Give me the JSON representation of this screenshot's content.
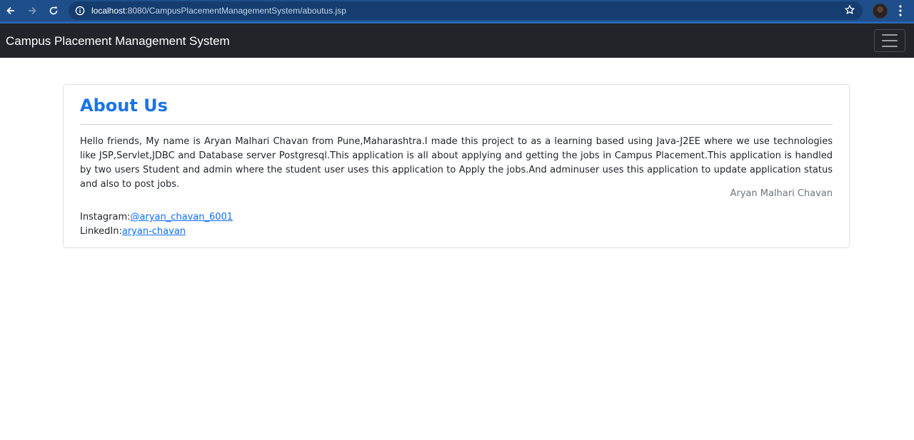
{
  "browser": {
    "url_host": "localhost",
    "url_rest": ":8080/CampusPlacementManagementSystem/aboutus.jsp"
  },
  "navbar": {
    "brand": "Campus Placement Management System"
  },
  "about": {
    "heading": "About Us",
    "paragraph": "Hello friends, My name is Aryan Malhari Chavan from Pune,Maharashtra.I made this project to as a learning based using Java-J2EE where we use technologies like JSP,Servlet,JDBC and Database server Postgresql.This application is all about applying and getting the jobs in Campus Placement.This application is handled by two users Student and admin where the student user uses this application to Apply the jobs.And adminuser uses this application to update application status and also to post jobs.",
    "signature": "Aryan Malhari Chavan",
    "instagram_label": "Instagram:",
    "instagram_handle": "@aryan_chavan_6001",
    "linkedin_label": "LinkedIn:",
    "linkedin_handle": "aryan-chavan"
  },
  "colors": {
    "chrome": "#1f4f8a",
    "navbar": "#212529",
    "heading": "#1a73e8",
    "link": "#0d6efd"
  }
}
